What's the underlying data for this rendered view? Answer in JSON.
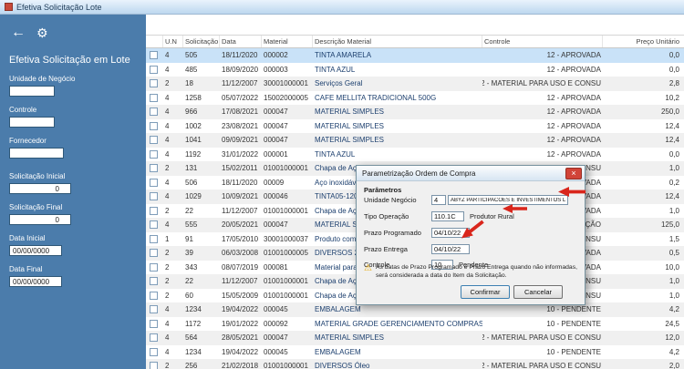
{
  "window": {
    "title": "Efetiva Solicitação Lote"
  },
  "icons": {
    "back": "←",
    "gear": "⚙",
    "close": "×",
    "warning": "⚠"
  },
  "colors": {
    "sidebar_blue": "#4b7cab",
    "selection_blue": "#c9e2f8",
    "annotation_red": "#d9261c",
    "warning_yellow": "#e8a800"
  },
  "sidebar": {
    "title": "Efetiva Solicitação em Lote",
    "fields": [
      {
        "label": "Unidade de Negócio",
        "value": ""
      },
      {
        "label": "Controle",
        "value": ""
      },
      {
        "label": "Fornecedor",
        "value": ""
      },
      {
        "label": "Solicitação Inicial",
        "value": "0"
      },
      {
        "label": "Solicitação Final",
        "value": "0"
      },
      {
        "label": "Data Inicial",
        "value": "00/00/0000"
      },
      {
        "label": "Data Final",
        "value": "00/00/0000"
      }
    ]
  },
  "table": {
    "columns": [
      "U.N",
      "Solicitação",
      "Data",
      "Material",
      "Descrição Material",
      "Controle",
      "Preço Unitário"
    ],
    "rows": [
      {
        "selected": true,
        "un": "4",
        "solicitacao": "505",
        "data": "18/11/2020",
        "material": "000002",
        "descricao": "TINTA AMARELA",
        "controle": "12 - APROVADA",
        "preco": "0,0"
      },
      {
        "selected": false,
        "un": "4",
        "solicitacao": "485",
        "data": "18/09/2020",
        "material": "000003",
        "descricao": "TINTA AZUL",
        "controle": "12 - APROVADA",
        "preco": "0,0"
      },
      {
        "selected": false,
        "un": "2",
        "solicitacao": "18",
        "data": "11/12/2007",
        "material": "30001000001",
        "descricao": "Serviços Geral",
        "controle": "2 - MATERIAL PARA USO E CONSU",
        "preco": "2,8"
      },
      {
        "selected": false,
        "un": "4",
        "solicitacao": "1258",
        "data": "05/07/2022",
        "material": "15002000005",
        "descricao": "CAFE MELLITA TRADICIONAL 500G",
        "controle": "12 - APROVADA",
        "preco": "10,2"
      },
      {
        "selected": false,
        "un": "4",
        "solicitacao": "966",
        "data": "17/08/2021",
        "material": "000047",
        "descricao": "MATERIAL SIMPLES",
        "controle": "12 - APROVADA",
        "preco": "250,0"
      },
      {
        "selected": false,
        "un": "4",
        "solicitacao": "1002",
        "data": "23/08/2021",
        "material": "000047",
        "descricao": "MATERIAL SIMPLES",
        "controle": "12 - APROVADA",
        "preco": "12,4"
      },
      {
        "selected": false,
        "un": "4",
        "solicitacao": "1041",
        "data": "09/09/2021",
        "material": "000047",
        "descricao": "MATERIAL SIMPLES",
        "controle": "12 - APROVADA",
        "preco": "12,4"
      },
      {
        "selected": false,
        "un": "4",
        "solicitacao": "1192",
        "data": "31/01/2022",
        "material": "000001",
        "descricao": "TINTA AZUL",
        "controle": "12 - APROVADA",
        "preco": "0,0"
      },
      {
        "selected": false,
        "un": "2",
        "solicitacao": "131",
        "data": "15/02/2011",
        "material": "01001000001",
        "descricao": "Chapa de Aço Inoxidável",
        "controle": "2 - MATERIAL PARA USO E CONSU",
        "preco": "1,0"
      },
      {
        "selected": false,
        "un": "4",
        "solicitacao": "506",
        "data": "18/11/2020",
        "material": "00009",
        "descricao": "Aço inoxidável",
        "controle": "12 - APROVADA",
        "preco": "0,2"
      },
      {
        "selected": false,
        "un": "4",
        "solicitacao": "1029",
        "data": "10/09/2021",
        "material": "000046",
        "descricao": "TINTA05-1206",
        "controle": "12 - APROVADA",
        "preco": "12,4"
      },
      {
        "selected": false,
        "un": "2",
        "solicitacao": "22",
        "data": "11/12/2007",
        "material": "01001000001",
        "descricao": "Chapa de Aço Inoxidável",
        "controle": "12 - APROVADA",
        "preco": "1,0"
      },
      {
        "selected": false,
        "un": "4",
        "solicitacao": "555",
        "data": "20/05/2021",
        "material": "000047",
        "descricao": "MATERIAL SIMPLES",
        "controle": "AGUARDANDO SOLICITAÇÃO",
        "preco": "125,0"
      },
      {
        "selected": false,
        "un": "1",
        "solicitacao": "91",
        "data": "17/05/2010",
        "material": "30001000037",
        "descricao": "Produto com Numeração",
        "controle": "2 - MATERIAL PARA USO E CONSU",
        "preco": "1,5"
      },
      {
        "selected": false,
        "un": "2",
        "solicitacao": "39",
        "data": "06/03/2008",
        "material": "01001000005",
        "descricao": "DIVERSOS 2",
        "controle": "5 - APROVADA",
        "preco": "0,5"
      },
      {
        "selected": false,
        "un": "2",
        "solicitacao": "343",
        "data": "08/07/2019",
        "material": "000081",
        "descricao": "Material para Consumo",
        "controle": "5 - APROVADA",
        "preco": "10,0"
      },
      {
        "selected": false,
        "un": "2",
        "solicitacao": "22",
        "data": "11/12/2007",
        "material": "01001000001",
        "descricao": "Chapa de Aço Inoxidável",
        "controle": "2 - MATERIAL PARA USO E CONSU",
        "preco": "1,0"
      },
      {
        "selected": false,
        "un": "2",
        "solicitacao": "60",
        "data": "15/05/2009",
        "material": "01001000001",
        "descricao": "Chapa de Aço Inoxidável",
        "controle": "2 - MATERIAL PARA USO E CONSU",
        "preco": "1,0"
      },
      {
        "selected": false,
        "un": "4",
        "solicitacao": "1234",
        "data": "19/04/2022",
        "material": "000045",
        "descricao": "EMBALAGEM",
        "controle": "10 - PENDENTE",
        "preco": "4,2"
      },
      {
        "selected": false,
        "un": "4",
        "solicitacao": "1172",
        "data": "19/01/2022",
        "material": "000092",
        "descricao": "MATERIAL GRADE GERENCIAMENTO COMPRAS",
        "controle": "10 - PENDENTE",
        "preco": "24,5"
      },
      {
        "selected": false,
        "un": "4",
        "solicitacao": "564",
        "data": "28/05/2021",
        "material": "000047",
        "descricao": "MATERIAL SIMPLES",
        "controle": "2 - MATERIAL PARA USO E CONSU",
        "preco": "12,0"
      },
      {
        "selected": false,
        "un": "4",
        "solicitacao": "1234",
        "data": "19/04/2022",
        "material": "000045",
        "descricao": "EMBALAGEM",
        "controle": "10 - PENDENTE",
        "preco": "4,2"
      },
      {
        "selected": false,
        "un": "2",
        "solicitacao": "256",
        "data": "21/02/2018",
        "material": "01001000001",
        "descricao": "DIVERSOS Óleo",
        "controle": "2 - MATERIAL PARA USO E CONSU",
        "preco": "2,0"
      }
    ]
  },
  "dialog": {
    "title": "Parametrização Ordem de Compra",
    "section_label": "Parâmetros",
    "fields": {
      "unidade_negocio": {
        "label": "Unidade Negócio",
        "code": "4",
        "description": "ABYZ PARTICIPACOES E INVESTIMENTOS LTDA"
      },
      "tipo_operacao": {
        "label": "Tipo Operação",
        "value": "110.1C",
        "description": "Produtor Rural"
      },
      "prazo_programado": {
        "label": "Prazo Programado",
        "value": "04/10/22"
      },
      "prazo_entrega": {
        "label": "Prazo Entrega",
        "value": "04/10/22"
      },
      "controle": {
        "label": "Controle",
        "value": "10",
        "description": "Pendente"
      }
    },
    "warning_text": "As datas de Prazo Programado e Prazo Entrega quando não informadas, será considerada a data do Item da Solicitação.",
    "buttons": {
      "confirm": "Confirmar",
      "cancel": "Cancelar"
    }
  }
}
